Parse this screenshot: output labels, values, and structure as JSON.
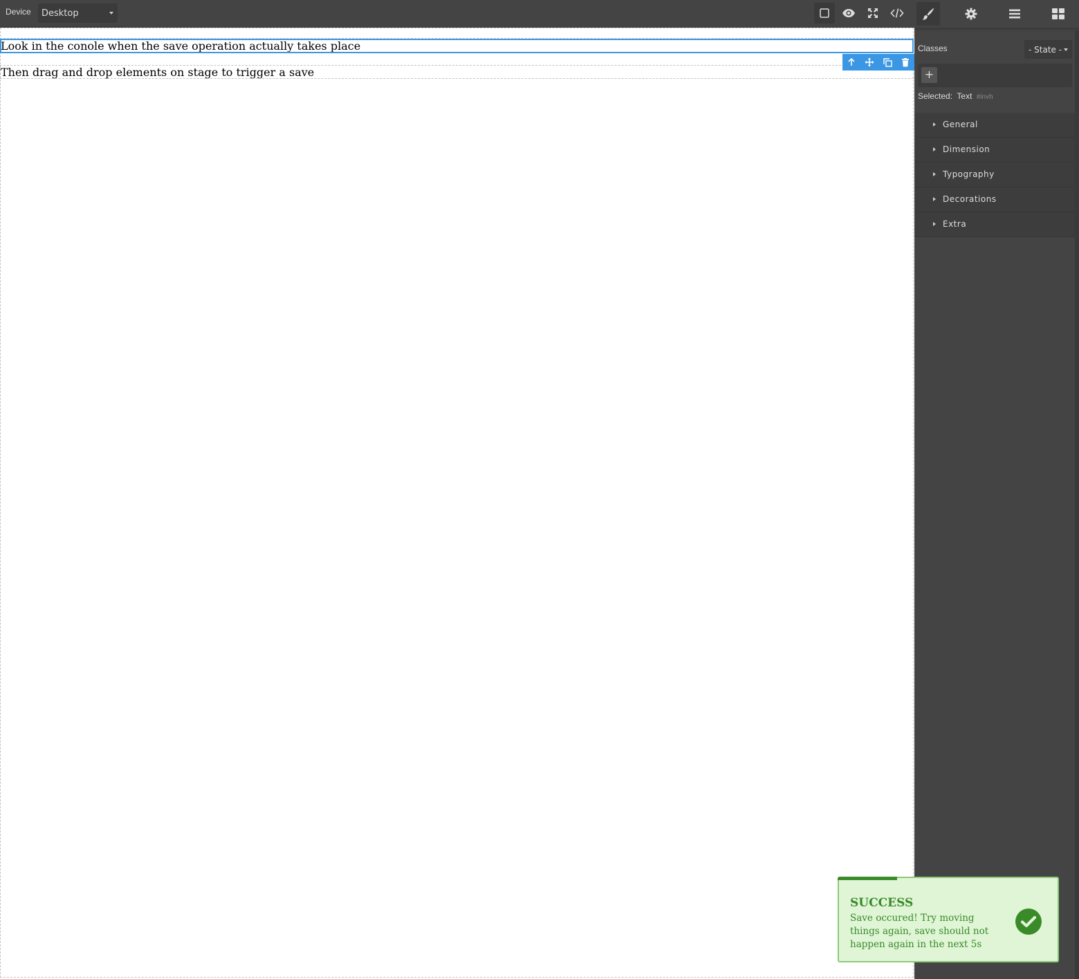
{
  "topbar": {
    "device_label": "Device",
    "device_value": "Desktop",
    "options": [
      {
        "name": "sw-visibility",
        "icon": "square-outline-icon",
        "active": true
      },
      {
        "name": "preview",
        "icon": "eye-icon",
        "active": false
      },
      {
        "name": "fullscreen",
        "icon": "fullscreen-icon",
        "active": false
      },
      {
        "name": "export-template",
        "icon": "code-icon",
        "active": false
      }
    ]
  },
  "panel": {
    "tabs": [
      {
        "name": "style-manager",
        "icon": "paint-brush-icon",
        "active": true
      },
      {
        "name": "trait-manager",
        "icon": "gear-icon",
        "active": false
      },
      {
        "name": "layer-manager",
        "icon": "bars-icon",
        "active": false
      },
      {
        "name": "blocks",
        "icon": "grid-icon",
        "active": false
      }
    ],
    "classes_label": "Classes",
    "state_value": "- State -",
    "add_class": "+",
    "selected_label": "Selected:",
    "selected_name": "Text",
    "selected_id": "#invh",
    "sectors": [
      "General",
      "Dimension",
      "Typography",
      "Decorations",
      "Extra"
    ]
  },
  "canvas": {
    "text1": "Look in the conole when the save operation actually takes place",
    "text2": "Then drag and drop elements on stage to trigger a save"
  },
  "toast": {
    "title": "SUCCESS",
    "message": "Save occured! Try moving things again, save should not happen again in the next 5s",
    "progress": 0.27
  },
  "colors": {
    "accent": "#3b97e3",
    "panel_bg": "#444444",
    "success_bg": "#dff5d6",
    "success_text": "#3a8a2a"
  }
}
